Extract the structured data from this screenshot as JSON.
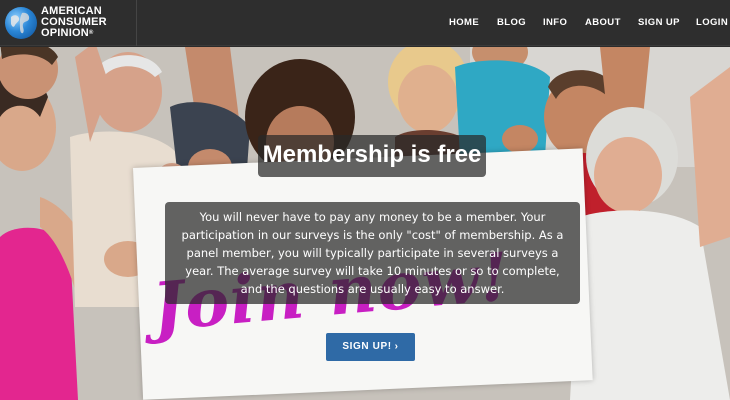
{
  "brand": {
    "line1": "AMERICAN",
    "line2": "CONSUMER",
    "line3": "OPINION",
    "registered": "®",
    "logo_icon": "globe-icon"
  },
  "nav": {
    "items": [
      {
        "label": "HOME"
      },
      {
        "label": "BLOG"
      },
      {
        "label": "INFO"
      },
      {
        "label": "ABOUT"
      },
      {
        "label": "SIGN UP"
      },
      {
        "label": "LOGIN"
      }
    ]
  },
  "hero": {
    "title": "Membership is free",
    "body": "You will never have to pay any money to be a member. Your participation in our surveys is the only \"cost\" of membership. As a panel member, you will typically participate in several surveys a year. The average survey will take 10 minutes or so to complete, and the questions are usually easy to answer.",
    "sign_text": "Join now!",
    "cta_label": "SIGN UP!",
    "cta_icon": "›"
  },
  "colors": {
    "header_bg": "#2e2e2e",
    "cta_bg": "#2f6aa6",
    "sign_text": "#c81fc3",
    "overlay": "rgba(40,40,40,0.72)"
  }
}
